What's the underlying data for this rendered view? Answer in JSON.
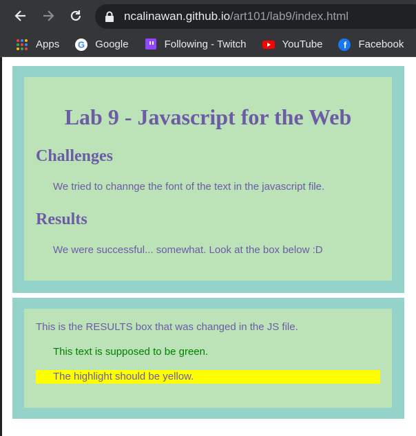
{
  "browser": {
    "url_host": "ncalinawan.github.io",
    "url_path": "/art101/lab9/index.html",
    "bookmarks": [
      {
        "label": "Apps"
      },
      {
        "label": "Google"
      },
      {
        "label": "Following - Twitch"
      },
      {
        "label": "YouTube"
      },
      {
        "label": "Facebook"
      }
    ]
  },
  "page": {
    "title": "Lab 9 - Javascript for the Web",
    "challenges_heading": "Challenges",
    "challenges_text": "We tried to channge the font of the text in the javascript file.",
    "results_heading": "Results",
    "results_text": "We were successful... somewhat. Look at the box below :D"
  },
  "results_box": {
    "line1": "This is the RESULTS box that was changed in the JS file.",
    "green_text": "This text is supposed to be green.",
    "highlight_text": "The highlight should be yellow."
  },
  "colors": {
    "outer_border": "#93d3ca",
    "inner_bg": "#bce2b7",
    "heading": "#6d5ba6",
    "green": "#008000",
    "highlight": "#ffff00"
  }
}
